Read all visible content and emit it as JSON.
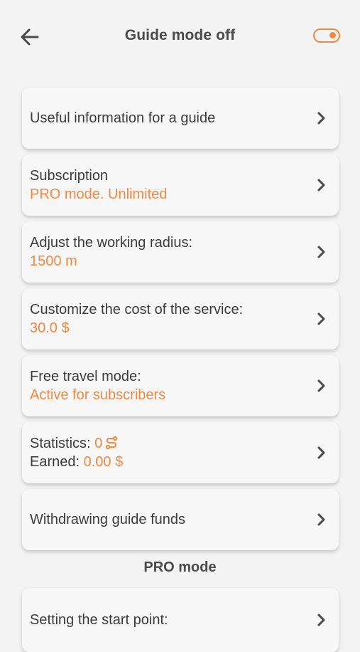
{
  "header": {
    "title": "Guide mode off",
    "back_icon": "arrow-left-icon",
    "toggle_state": "off",
    "accent_color": "#ef8a45"
  },
  "menu": {
    "useful_info": {
      "label": "Useful information for a guide"
    },
    "subscription": {
      "label": "Subscription",
      "value": "PRO mode. Unlimited"
    },
    "radius": {
      "label": "Adjust the working radius:",
      "value": "1500 m"
    },
    "cost": {
      "label": "Customize the cost of the service:",
      "value": "30.0 $"
    },
    "free_travel": {
      "label": "Free travel mode:",
      "value": "Active for subscribers"
    },
    "statistics": {
      "label": "Statistics: ",
      "count": "0",
      "count_icon": "route-icon",
      "earned_label": "Earned: ",
      "earned_value": "0.00 $"
    },
    "withdraw": {
      "label": "Withdrawing guide funds"
    }
  },
  "pro_section": {
    "title": "PRO mode",
    "start_point": {
      "label": "Setting the start point:"
    }
  }
}
